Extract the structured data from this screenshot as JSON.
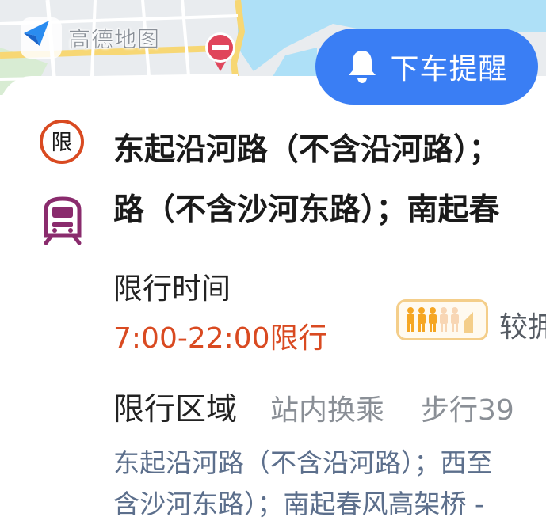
{
  "map": {
    "logo_text": "高德地图",
    "logo_icon": "navigation-arrow-icon",
    "pin_icon": "no-entry-icon"
  },
  "reminder": {
    "label": "下车提醒",
    "icon": "bell-icon"
  },
  "restriction": {
    "icon": "limit-icon",
    "icon_text": "限",
    "transport_icon": "metro-icon",
    "title_line1": "东起沿河路（不含沿河路）；",
    "title_line2": "路（不含沙河东路）；南起春",
    "time_label": "限行时间",
    "time_value": "7:00-22:00限行",
    "crowd_label": "较拥",
    "crowd_level": "3/5",
    "area_label": "限行区域",
    "transfer_label": "站内换乘",
    "walk_label": "步行39",
    "area_desc_line1": "东起沿河路（不含沿河路）；西至",
    "area_desc_line2": "含沙河东路）；南起春风高架桥 -"
  },
  "colors": {
    "accent_blue": "#3a7ef4",
    "limit_red": "#d94a21",
    "metro_purple": "#8a2b6d",
    "crowd_orange": "#f5a623",
    "desc_blue_gray": "#5c6f8c"
  }
}
